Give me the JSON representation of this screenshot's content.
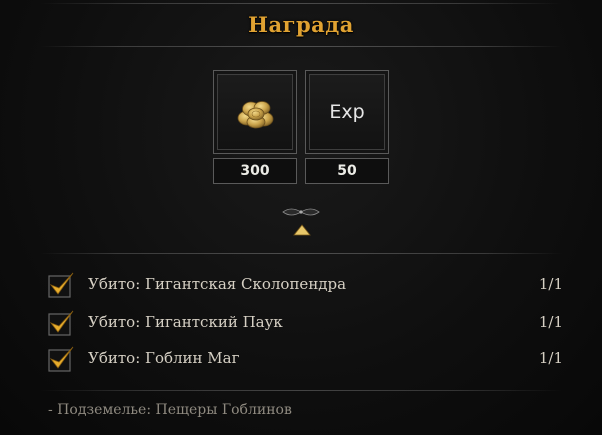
{
  "title": "Награда",
  "rewards": [
    {
      "icon": "gold-coins-icon",
      "quantity": "300"
    },
    {
      "icon": "exp-icon",
      "label": "Exp",
      "quantity": "50"
    }
  ],
  "objectives": [
    {
      "text": "Убито: Гигантская Сколопендра",
      "progress": "1/1",
      "completed": true
    },
    {
      "text": "Убито: Гигантский Паук",
      "progress": "1/1",
      "completed": true
    },
    {
      "text": "Убито: Гоблин Маг",
      "progress": "1/1",
      "completed": true
    }
  ],
  "location": "- Подземелье: Пещеры Гоблинов",
  "colors": {
    "title": "#e0a232",
    "check": "#e7ad2d",
    "text": "#d6d0c4",
    "muted": "#8f8a80"
  }
}
